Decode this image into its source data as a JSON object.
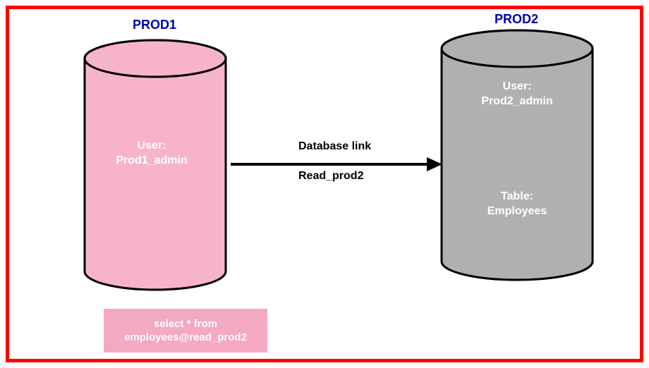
{
  "db1": {
    "title": "PROD1",
    "user_label": "User:",
    "user_name": "Prod1_admin",
    "fill": "#f8b3cc",
    "stroke": "#000"
  },
  "db2": {
    "title": "PROD2",
    "user_label": "User:",
    "user_name": "Prod2_admin",
    "table_label": "Table:",
    "table_name": "Employees",
    "fill": "#b0b0b0",
    "stroke": "#000"
  },
  "link": {
    "label_top": "Database link",
    "label_bottom": "Read_prod2"
  },
  "query": {
    "line1": "select * from",
    "line2": "employees@read_prod2"
  },
  "colors": {
    "frame": "#ff0000",
    "title": "#0000aa"
  }
}
